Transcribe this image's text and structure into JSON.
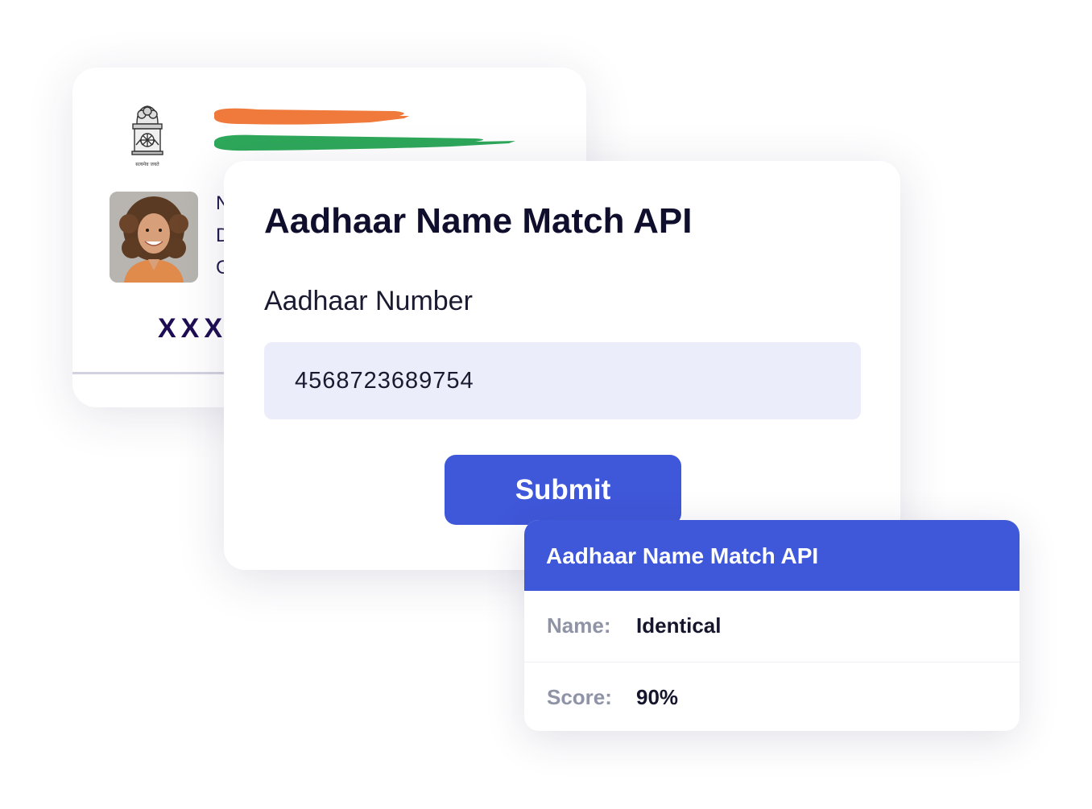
{
  "aadhaar_card": {
    "emblem_caption": "सत्यमेव जयते",
    "detail_lines": [
      "N",
      "D",
      "G"
    ],
    "masked_number": "XXX",
    "colors": {
      "saffron": "#f07a3c",
      "green": "#2ea85a",
      "number": "#1e0d52"
    }
  },
  "form": {
    "title": "Aadhaar Name Match API",
    "field_label": "Aadhaar Number",
    "aadhaar_number": "4568723689754",
    "submit_label": "Submit"
  },
  "result": {
    "title": "Aadhaar Name Match API",
    "rows": [
      {
        "key": "Name:",
        "value": "Identical"
      },
      {
        "key": "Score:",
        "value": "90%"
      }
    ]
  },
  "colors": {
    "accent": "#3f57d9",
    "input_bg": "#ecedfa",
    "heading": "#0f0f2d",
    "muted_label": "#8f93a6"
  }
}
